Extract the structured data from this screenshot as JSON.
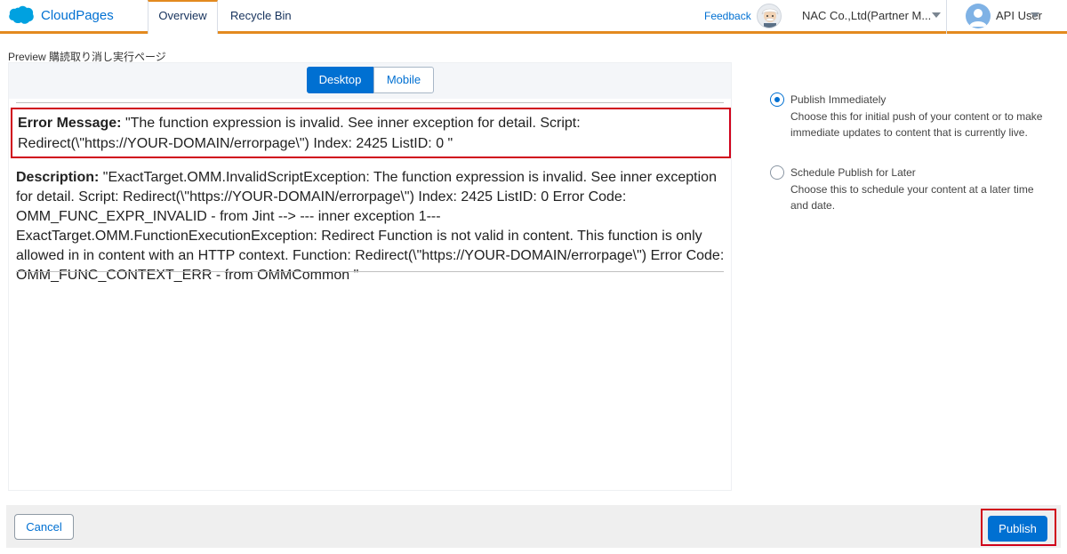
{
  "header": {
    "app_name": "CloudPages",
    "tabs": [
      {
        "label": "Overview",
        "active": true
      },
      {
        "label": "Recycle Bin",
        "active": false
      }
    ],
    "feedback_label": "Feedback",
    "org_name": "NAC Co.,Ltd(Partner M...",
    "user_name": "API User",
    "accent_color": "#e38a1f"
  },
  "preview": {
    "label": "Preview 購読取り消し実行ページ",
    "view_modes": [
      "Desktop",
      "Mobile"
    ],
    "selected_view": "Desktop",
    "error": {
      "label": "Error Message:",
      "text": " \"The function expression is invalid. See inner exception for detail. Script: Redirect(\\\"https://YOUR-DOMAIN/errorpage\\\") Index: 2425 ListID: 0 \""
    },
    "description": {
      "label": "Description:",
      "text": " \"ExactTarget.OMM.InvalidScriptException: The function expression is invalid. See inner exception for detail. Script: Redirect(\\\"https://YOUR-DOMAIN/errorpage\\\") Index: 2425 ListID: 0 Error Code: OMM_FUNC_EXPR_INVALID - from Jint --> --- inner exception 1--- ExactTarget.OMM.FunctionExecutionException: Redirect Function is not valid in content. This function is only allowed in in content with an HTTP context. Function: Redirect(\\\"https://YOUR-DOMAIN/errorpage\\\") Error Code: OMM_FUNC_CONTEXT_ERR - from OMMCommon \""
    }
  },
  "publish_options": [
    {
      "title": "Publish Immediately",
      "description": "Choose this for initial push of your content or to make immediate updates to content that is currently live.",
      "selected": true
    },
    {
      "title": "Schedule Publish for Later",
      "description": "Choose this to schedule your content at a later time and date.",
      "selected": false
    }
  ],
  "footer": {
    "cancel_label": "Cancel",
    "publish_label": "Publish"
  },
  "colors": {
    "primary": "#0070d2",
    "highlight_border": "#d0021b"
  }
}
